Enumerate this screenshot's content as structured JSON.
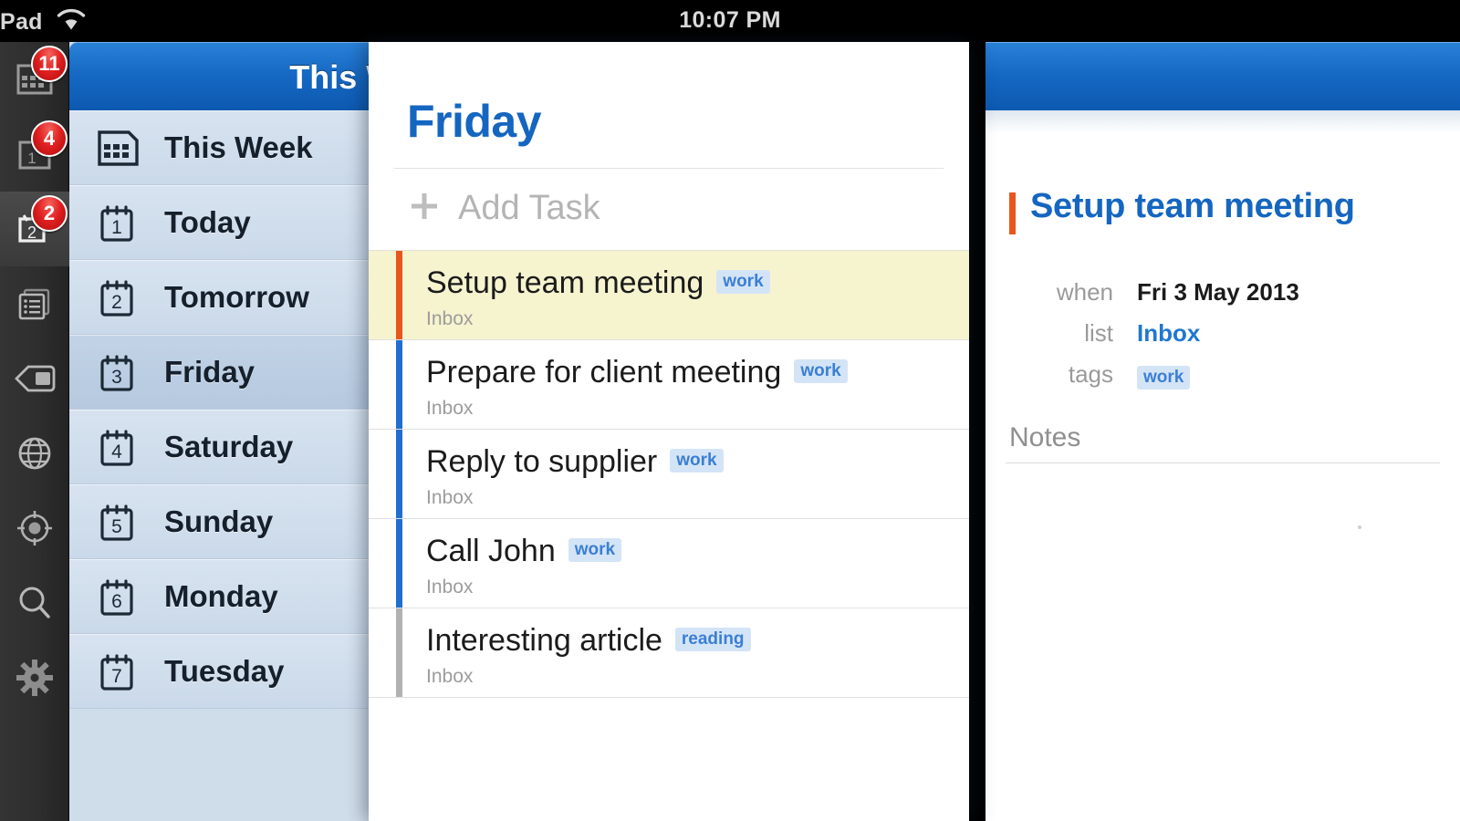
{
  "status_bar": {
    "carrier": "Pad",
    "wifi_icon": "wifi-icon",
    "time": "10:07 PM"
  },
  "rail": {
    "items": [
      {
        "icon": "calendar-grid-icon",
        "badge": "11",
        "active": false
      },
      {
        "icon": "calendar-day-1-icon",
        "badge": "4",
        "active": false
      },
      {
        "icon": "calendar-day-2-icon",
        "badge": "2",
        "active": true
      },
      {
        "icon": "lists-icon",
        "badge": "",
        "active": false
      },
      {
        "icon": "tag-icon",
        "badge": "",
        "active": false
      },
      {
        "icon": "globe-icon",
        "badge": "",
        "active": false
      },
      {
        "icon": "focus-target-icon",
        "badge": "",
        "active": false
      },
      {
        "icon": "search-icon",
        "badge": "",
        "active": false
      },
      {
        "icon": "gear-icon",
        "badge": "",
        "active": false
      }
    ]
  },
  "list_column": {
    "header_title": "This Week",
    "items": [
      {
        "label": "This Week",
        "day": "",
        "icon": "calendar-grid-icon",
        "selected": false
      },
      {
        "label": "Today",
        "day": "1",
        "icon": "calendar-day-icon",
        "selected": false
      },
      {
        "label": "Tomorrow",
        "day": "2",
        "icon": "calendar-day-icon",
        "selected": false
      },
      {
        "label": "Friday",
        "day": "3",
        "icon": "calendar-day-icon",
        "selected": true
      },
      {
        "label": "Saturday",
        "day": "4",
        "icon": "calendar-day-icon",
        "selected": false
      },
      {
        "label": "Sunday",
        "day": "5",
        "icon": "calendar-day-icon",
        "selected": false
      },
      {
        "label": "Monday",
        "day": "6",
        "icon": "calendar-day-icon",
        "selected": false
      },
      {
        "label": "Tuesday",
        "day": "7",
        "icon": "calendar-day-icon",
        "selected": false
      }
    ]
  },
  "overlay_panel": {
    "title": "Friday",
    "add_task_label": "Add Task",
    "add_task_icon": "plus-icon",
    "tasks": [
      {
        "title": "Setup team meeting",
        "tag": "work",
        "list": "Inbox",
        "priority_color": "#e8561d",
        "highlighted": true
      },
      {
        "title": "Prepare for client meeting",
        "tag": "work",
        "list": "Inbox",
        "priority_color": "#1f6fd0",
        "highlighted": false
      },
      {
        "title": "Reply to supplier",
        "tag": "work",
        "list": "Inbox",
        "priority_color": "#1f6fd0",
        "highlighted": false
      },
      {
        "title": "Call John",
        "tag": "work",
        "list": "Inbox",
        "priority_color": "#1f6fd0",
        "highlighted": false
      },
      {
        "title": "Interesting article",
        "tag": "reading",
        "list": "Inbox",
        "priority_color": "#b2b2b2",
        "highlighted": false
      }
    ]
  },
  "detail_panel": {
    "title": "Setup team meeting",
    "priority_color": "#e8561d",
    "meta": {
      "when_label": "when",
      "when_value": "Fri 3 May 2013",
      "list_label": "list",
      "list_value": "Inbox",
      "tags_label": "tags",
      "tags_value": "work"
    },
    "notes_heading": "Notes",
    "notes_value": ""
  },
  "colors": {
    "header_blue": "#1568c3",
    "accent_blue": "#1566c0",
    "priority_orange": "#e8561d",
    "priority_blue": "#1f6fd0",
    "priority_gray": "#b2b2b2",
    "tag_bg": "#d4e4f7",
    "tag_text": "#3b7fd4",
    "highlight_yellow": "#f6f3cf",
    "badge_red": "#e02020"
  }
}
